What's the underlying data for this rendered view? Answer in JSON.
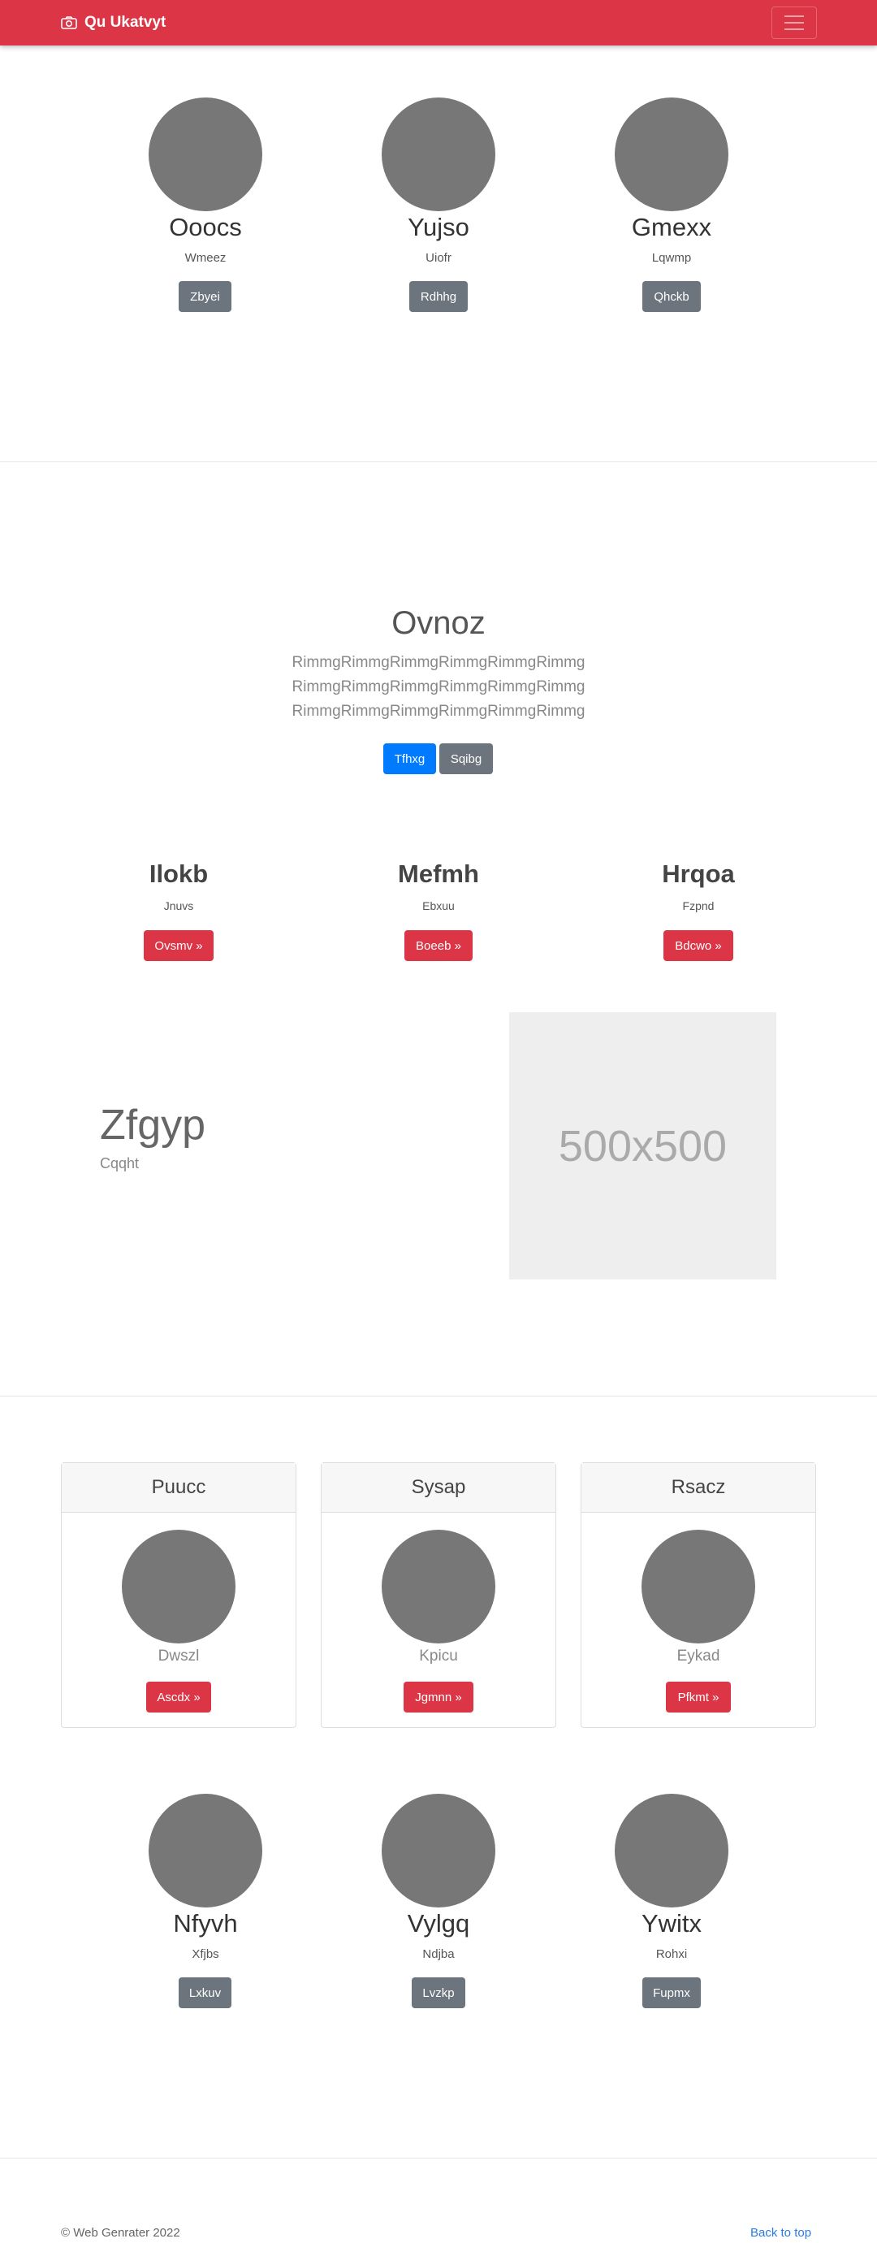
{
  "navbar": {
    "brand": "Qu Ukatvyt",
    "brand_color": "#dc3545"
  },
  "profiles_top": [
    {
      "name": "Ooocs",
      "sub": "Wmeez",
      "button": "Zbyei"
    },
    {
      "name": "Yujso",
      "sub": "Uiofr",
      "button": "Rdhhg"
    },
    {
      "name": "Gmexx",
      "sub": "Lqwmp",
      "button": "Qhckb"
    }
  ],
  "hero": {
    "title": "Ovnoz",
    "lines": [
      "RimmgRimmgRimmgRimmgRimmgRimmg",
      "RimmgRimmgRimmgRimmgRimmgRimmg",
      "RimmgRimmgRimmgRimmgRimmgRimmg"
    ],
    "primary_button": "Tfhxg",
    "secondary_button": "Sqibg"
  },
  "features": [
    {
      "title": "Ilokb",
      "sub": "Jnuvs",
      "button": "Ovsmv »"
    },
    {
      "title": "Mefmh",
      "sub": "Ebxuu",
      "button": "Boeeb »"
    },
    {
      "title": "Hrqoa",
      "sub": "Fzpnd",
      "button": "Bdcwo »"
    }
  ],
  "split": {
    "title": "Zfgyp",
    "sub": "Cqqht",
    "image_label": "500x500"
  },
  "cards": [
    {
      "header": "Puucc",
      "text": "Dwszl",
      "button": "Ascdx »"
    },
    {
      "header": "Sysap",
      "text": "Kpicu",
      "button": "Jgmnn »"
    },
    {
      "header": "Rsacz",
      "text": "Eykad",
      "button": "Pfkmt »"
    }
  ],
  "profiles_bottom": [
    {
      "name": "Nfyvh",
      "sub": "Xfjbs",
      "button": "Lxkuv"
    },
    {
      "name": "Vylgq",
      "sub": "Ndjba",
      "button": "Lvzkp"
    },
    {
      "name": "Ywitx",
      "sub": "Rohxi",
      "button": "Fupmx"
    }
  ],
  "footer": {
    "copyright": "© Web Genrater 2022",
    "back_to_top": "Back to top"
  }
}
